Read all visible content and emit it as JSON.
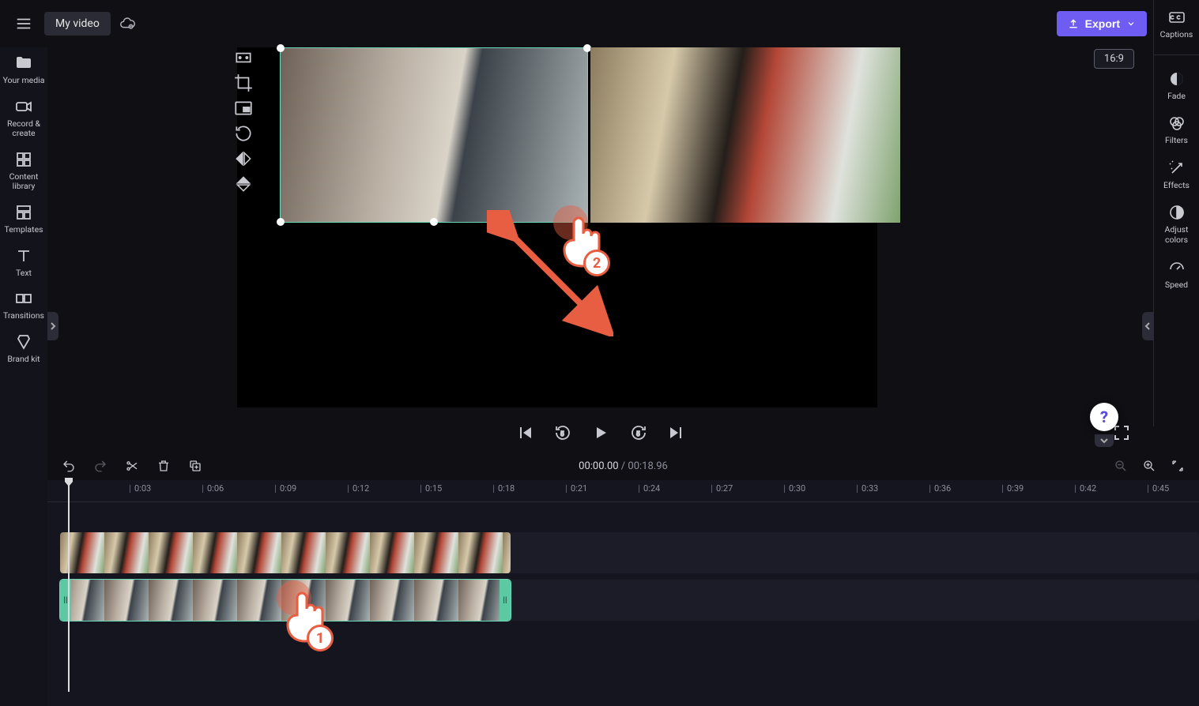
{
  "app_title": "My video",
  "export_label": "Export",
  "aspect_ratio": "16:9",
  "left_sidebar": [
    {
      "icon": "media",
      "label": "Your media"
    },
    {
      "icon": "record",
      "label": "Record & create"
    },
    {
      "icon": "library",
      "label": "Content library"
    },
    {
      "icon": "templates",
      "label": "Templates"
    },
    {
      "icon": "text",
      "label": "Text"
    },
    {
      "icon": "transitions",
      "label": "Transitions"
    },
    {
      "icon": "brandkit",
      "label": "Brand kit"
    }
  ],
  "right_sidebar": [
    {
      "icon": "captions",
      "label": "Captions"
    },
    {
      "icon": "fade",
      "label": "Fade"
    },
    {
      "icon": "filters",
      "label": "Filters"
    },
    {
      "icon": "effects",
      "label": "Effects"
    },
    {
      "icon": "adjust",
      "label": "Adjust colors"
    },
    {
      "icon": "speed",
      "label": "Speed"
    }
  ],
  "playback": {
    "current": "00:00.00",
    "total": "00:18.96",
    "separator": " / "
  },
  "ruler_ticks": [
    "0:03",
    "0:06",
    "0:09",
    "0:12",
    "0:15",
    "0:18",
    "0:21",
    "0:24",
    "0:27",
    "0:30",
    "0:33",
    "0:36",
    "0:39",
    "0:42",
    "0:45"
  ],
  "overlay_badges": {
    "canvas": "2",
    "timeline": "1"
  },
  "help_label": "?",
  "timeline": {
    "track_count": 2,
    "selected_track_index": 1
  }
}
